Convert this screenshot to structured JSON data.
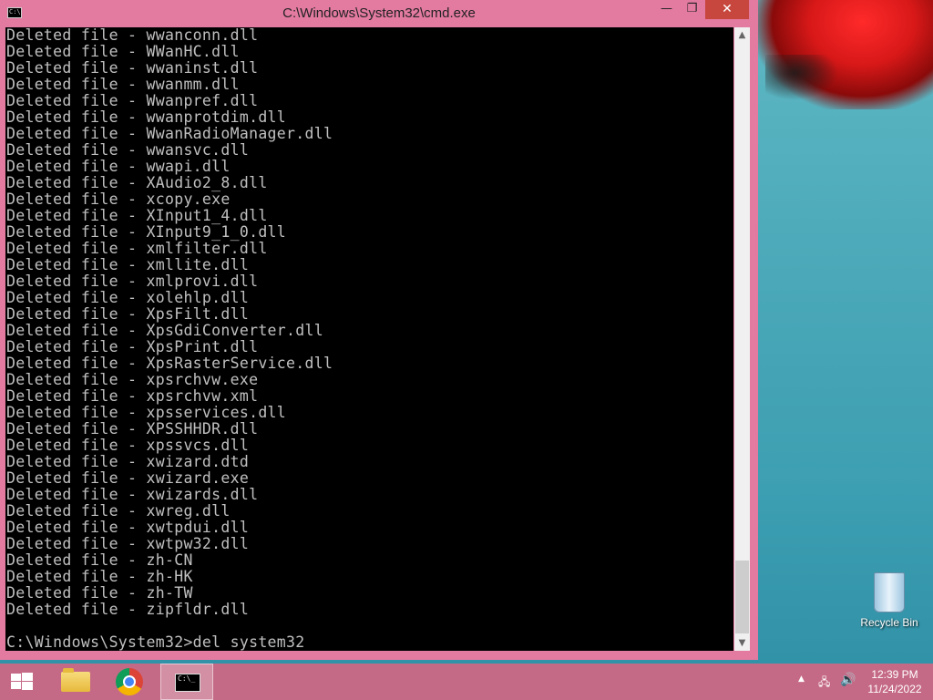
{
  "window": {
    "title": "C:\\Windows\\System32\\cmd.exe",
    "icon_text": "C:\\",
    "controls": {
      "minimize": "—",
      "restore": "❐",
      "close": "✕"
    }
  },
  "console": {
    "lines": [
      "Deleted file - wwanconn.dll",
      "Deleted file - WWanHC.dll",
      "Deleted file - wwaninst.dll",
      "Deleted file - wwanmm.dll",
      "Deleted file - Wwanpref.dll",
      "Deleted file - wwanprotdim.dll",
      "Deleted file - WwanRadioManager.dll",
      "Deleted file - wwansvc.dll",
      "Deleted file - wwapi.dll",
      "Deleted file - XAudio2_8.dll",
      "Deleted file - xcopy.exe",
      "Deleted file - XInput1_4.dll",
      "Deleted file - XInput9_1_0.dll",
      "Deleted file - xmlfilter.dll",
      "Deleted file - xmllite.dll",
      "Deleted file - xmlprovi.dll",
      "Deleted file - xolehlp.dll",
      "Deleted file - XpsFilt.dll",
      "Deleted file - XpsGdiConverter.dll",
      "Deleted file - XpsPrint.dll",
      "Deleted file - XpsRasterService.dll",
      "Deleted file - xpsrchvw.exe",
      "Deleted file - xpsrchvw.xml",
      "Deleted file - xpsservices.dll",
      "Deleted file - XPSSHHDR.dll",
      "Deleted file - xpssvcs.dll",
      "Deleted file - xwizard.dtd",
      "Deleted file - xwizard.exe",
      "Deleted file - xwizards.dll",
      "Deleted file - xwreg.dll",
      "Deleted file - xwtpdui.dll",
      "Deleted file - xwtpw32.dll",
      "Deleted file - zh-CN",
      "Deleted file - zh-HK",
      "Deleted file - zh-TW",
      "Deleted file - zipfldr.dll"
    ],
    "prompt": "C:\\Windows\\System32>del system32"
  },
  "scrollbar": {
    "up_arrow": "▲",
    "down_arrow": "▼"
  },
  "desktop": {
    "recycle_bin_label": "Recycle Bin"
  },
  "taskbar": {
    "cmd_icon_text": "C:\\_",
    "tray": {
      "show_hidden": "▲",
      "network": "🖧",
      "volume": "🔊"
    },
    "clock": {
      "time": "12:39 PM",
      "date": "11/24/2022"
    }
  }
}
